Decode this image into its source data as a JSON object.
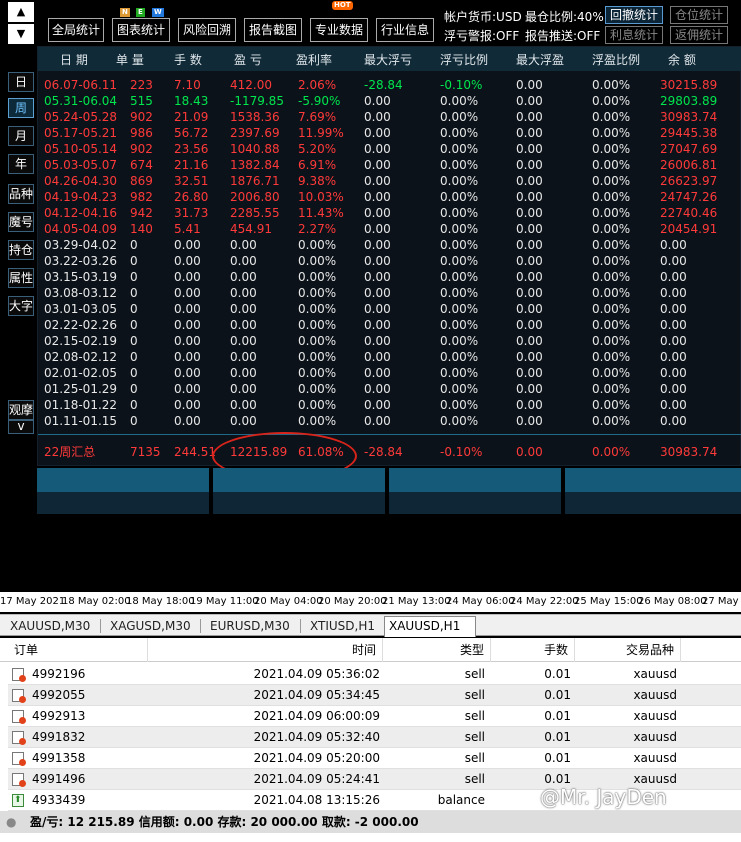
{
  "toolbar": {
    "buttons": [
      "全局统计",
      "图表统计",
      "风险回溯",
      "报告截图",
      "专业数据",
      "行业信息"
    ],
    "badges": {
      "n": "N",
      "e": "E",
      "w": "W",
      "hot": "HOT"
    },
    "account_currency": "帐户货币:USD",
    "max_position": "最仓比例:40%",
    "float_alert": "浮亏警报:OFF",
    "report_push": "报告推送:OFF",
    "right_buttons": [
      "回撤统计",
      "仓位统计",
      "利息统计",
      "返佣统计"
    ]
  },
  "nav": {
    "up_arrow": "▲",
    "items": [
      "日",
      "周",
      "月",
      "年",
      "品种",
      "魔号",
      "持仓",
      "属性",
      "大字",
      "观摩"
    ],
    "down_arrow": "v"
  },
  "table": {
    "headers": [
      "日 期",
      "单 量",
      "手 数",
      "盈 亏",
      "盈利率",
      "最大浮亏",
      "浮亏比例",
      "最大浮盈",
      "浮盈比例",
      "余 额"
    ],
    "rows": [
      [
        "06.07-06.11",
        "223",
        "7.10",
        "412.00",
        "2.06%",
        "-28.84",
        "-0.10%",
        "0.00",
        "0.00%",
        "30215.89"
      ],
      [
        "05.31-06.04",
        "515",
        "18.43",
        "-1179.85",
        "-5.90%",
        "0.00",
        "0.00%",
        "0.00",
        "0.00%",
        "29803.89"
      ],
      [
        "05.24-05.28",
        "902",
        "21.09",
        "1538.36",
        "7.69%",
        "0.00",
        "0.00%",
        "0.00",
        "0.00%",
        "30983.74"
      ],
      [
        "05.17-05.21",
        "986",
        "56.72",
        "2397.69",
        "11.99%",
        "0.00",
        "0.00%",
        "0.00",
        "0.00%",
        "29445.38"
      ],
      [
        "05.10-05.14",
        "902",
        "23.56",
        "1040.88",
        "5.20%",
        "0.00",
        "0.00%",
        "0.00",
        "0.00%",
        "27047.69"
      ],
      [
        "05.03-05.07",
        "674",
        "21.16",
        "1382.84",
        "6.91%",
        "0.00",
        "0.00%",
        "0.00",
        "0.00%",
        "26006.81"
      ],
      [
        "04.26-04.30",
        "869",
        "32.51",
        "1876.71",
        "9.38%",
        "0.00",
        "0.00%",
        "0.00",
        "0.00%",
        "26623.97"
      ],
      [
        "04.19-04.23",
        "982",
        "26.80",
        "2006.80",
        "10.03%",
        "0.00",
        "0.00%",
        "0.00",
        "0.00%",
        "24747.26"
      ],
      [
        "04.12-04.16",
        "942",
        "31.73",
        "2285.55",
        "11.43%",
        "0.00",
        "0.00%",
        "0.00",
        "0.00%",
        "22740.46"
      ],
      [
        "04.05-04.09",
        "140",
        "5.41",
        "454.91",
        "2.27%",
        "0.00",
        "0.00%",
        "0.00",
        "0.00%",
        "20454.91"
      ],
      [
        "03.29-04.02",
        "0",
        "0.00",
        "0.00",
        "0.00%",
        "0.00",
        "0.00%",
        "0.00",
        "0.00%",
        "0.00"
      ],
      [
        "03.22-03.26",
        "0",
        "0.00",
        "0.00",
        "0.00%",
        "0.00",
        "0.00%",
        "0.00",
        "0.00%",
        "0.00"
      ],
      [
        "03.15-03.19",
        "0",
        "0.00",
        "0.00",
        "0.00%",
        "0.00",
        "0.00%",
        "0.00",
        "0.00%",
        "0.00"
      ],
      [
        "03.08-03.12",
        "0",
        "0.00",
        "0.00",
        "0.00%",
        "0.00",
        "0.00%",
        "0.00",
        "0.00%",
        "0.00"
      ],
      [
        "03.01-03.05",
        "0",
        "0.00",
        "0.00",
        "0.00%",
        "0.00",
        "0.00%",
        "0.00",
        "0.00%",
        "0.00"
      ],
      [
        "02.22-02.26",
        "0",
        "0.00",
        "0.00",
        "0.00%",
        "0.00",
        "0.00%",
        "0.00",
        "0.00%",
        "0.00"
      ],
      [
        "02.15-02.19",
        "0",
        "0.00",
        "0.00",
        "0.00%",
        "0.00",
        "0.00%",
        "0.00",
        "0.00%",
        "0.00"
      ],
      [
        "02.08-02.12",
        "0",
        "0.00",
        "0.00",
        "0.00%",
        "0.00",
        "0.00%",
        "0.00",
        "0.00%",
        "0.00"
      ],
      [
        "02.01-02.05",
        "0",
        "0.00",
        "0.00",
        "0.00%",
        "0.00",
        "0.00%",
        "0.00",
        "0.00%",
        "0.00"
      ],
      [
        "01.25-01.29",
        "0",
        "0.00",
        "0.00",
        "0.00%",
        "0.00",
        "0.00%",
        "0.00",
        "0.00%",
        "0.00"
      ],
      [
        "01.18-01.22",
        "0",
        "0.00",
        "0.00",
        "0.00%",
        "0.00",
        "0.00%",
        "0.00",
        "0.00%",
        "0.00"
      ],
      [
        "01.11-01.15",
        "0",
        "0.00",
        "0.00",
        "0.00%",
        "0.00",
        "0.00%",
        "0.00",
        "0.00%",
        "0.00"
      ]
    ],
    "summary": [
      "22周汇总",
      "7135",
      "244.51",
      "12215.89",
      "61.08%",
      "-28.84",
      "-0.10%",
      "0.00",
      "0.00%",
      "30983.74"
    ]
  },
  "timeaxis": [
    "17 May 2021",
    "18 May 02:00",
    "18 May 18:00",
    "19 May 11:00",
    "20 May 04:00",
    "20 May 20:00",
    "21 May 13:00",
    "24 May 06:00",
    "24 May 22:00",
    "25 May 15:00",
    "26 May 08:00",
    "27 May 0"
  ],
  "tabs": [
    "XAUUSD,M30",
    "XAGUSD,M30",
    "EURUSD,M30",
    "XTIUSD,H1",
    "XAUUSD,H1"
  ],
  "orders": {
    "headers": [
      "订单",
      "时间",
      "类型",
      "手数",
      "交易品种"
    ],
    "rows": [
      {
        "id": "4992196",
        "time": "2021.04.09 05:36:02",
        "type": "sell",
        "lots": "0.01",
        "symbol": "xauusd",
        "kind": "sell"
      },
      {
        "id": "4992055",
        "time": "2021.04.09 05:34:45",
        "type": "sell",
        "lots": "0.01",
        "symbol": "xauusd",
        "kind": "sell"
      },
      {
        "id": "4992913",
        "time": "2021.04.09 06:00:09",
        "type": "sell",
        "lots": "0.01",
        "symbol": "xauusd",
        "kind": "sell"
      },
      {
        "id": "4991832",
        "time": "2021.04.09 05:32:40",
        "type": "sell",
        "lots": "0.01",
        "symbol": "xauusd",
        "kind": "sell"
      },
      {
        "id": "4991358",
        "time": "2021.04.09 05:20:00",
        "type": "sell",
        "lots": "0.01",
        "symbol": "xauusd",
        "kind": "sell"
      },
      {
        "id": "4991496",
        "time": "2021.04.09 05:24:41",
        "type": "sell",
        "lots": "0.01",
        "symbol": "xauusd",
        "kind": "sell"
      },
      {
        "id": "4933439",
        "time": "2021.04.08 13:15:26",
        "type": "balance",
        "lots": "",
        "symbol": "",
        "kind": "balance"
      }
    ],
    "summary": "盈/亏: 12 215.89  信用额: 0.00  存款: 20 000.00  取款: -2 000.00"
  },
  "watermark": "@Mr. JayDen",
  "colors": {
    "loss": "#ff3a3a",
    "gain": "#00e64d",
    "accent": "#5ba0d0"
  }
}
